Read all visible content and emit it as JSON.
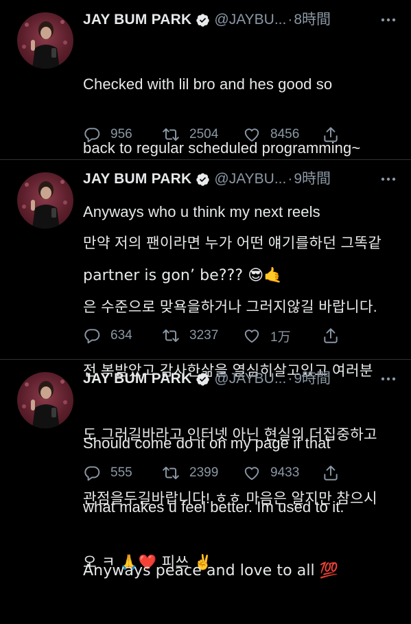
{
  "colors": {
    "background": "#000000",
    "text": "#e7e9ea",
    "secondary": "#8b98a5",
    "divider": "#2f3336",
    "verified": "#e7e9ea"
  },
  "tweets": [
    {
      "name": "JAY BUM PARK",
      "handle": "@JAYBU...",
      "separator": "·",
      "time": "8時間",
      "lines": [
        "Checked with lil bro and hes good so",
        "back to regular scheduled programming~",
        "Anyways who u think my next reels",
        "partner is gon’ be??? 😎🤙"
      ],
      "replies": "956",
      "retweets": "2504",
      "likes": "8456",
      "icons": [
        "reply-icon",
        "retweet-icon",
        "like-icon",
        "share-icon",
        "more-icon",
        "verified-badge-icon"
      ]
    },
    {
      "name": "JAY BUM PARK",
      "handle": "@JAYBU...",
      "separator": "·",
      "time": "9時間",
      "lines": [
        "만약 저의 팬이라면 누가 어떤 얘기를하던 그똑같",
        "은 수준으로 맞욕을하거나 그러지않길 바랍니다.",
        "전 복받았고 감사한삶을 열심히살고있고 여러분",
        "도 그러길바라고 인터넷 아닌 현실의 더집중하고",
        "관점을두길바랍니다! ㅎㅎ 마음은 알지만 참으시",
        "오 ㅋ 🙏❤️ 피쓰 ✌️"
      ],
      "replies": "634",
      "retweets": "3237",
      "likes": "1万"
    },
    {
      "name": "JAY BUM PARK",
      "handle": "@JAYBU...",
      "separator": "·",
      "time": "9時間",
      "lines": [
        "Should come do it on my page if that",
        "what makes u feel better. Im used to it.",
        "Anyways peace and love to all 💯"
      ],
      "replies": "555",
      "retweets": "2399",
      "likes": "9433"
    }
  ]
}
